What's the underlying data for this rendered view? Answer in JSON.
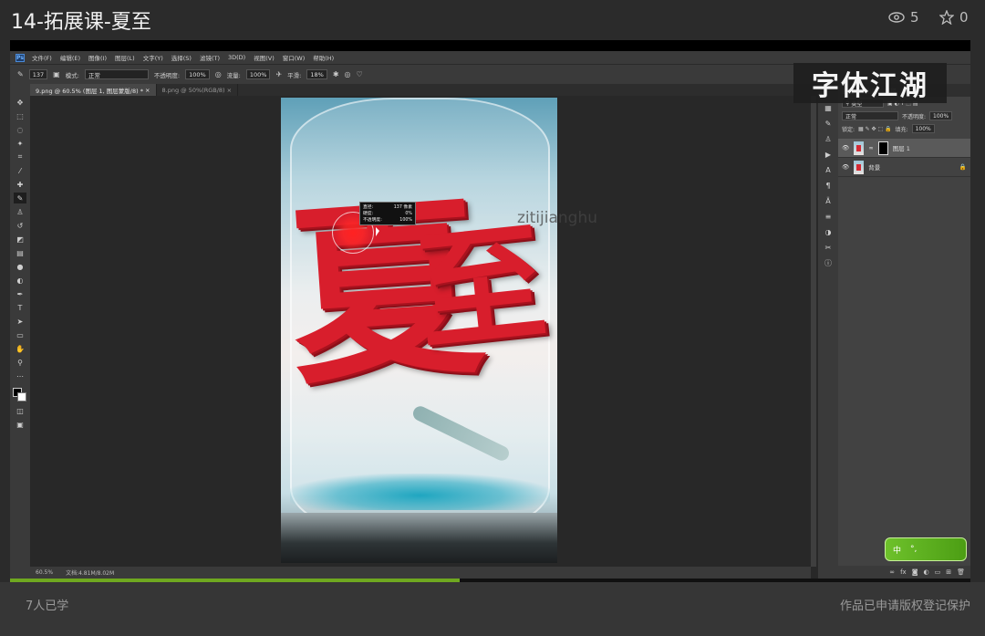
{
  "header": {
    "title": "14-拓展课-夏至",
    "views": "5",
    "stars": "0"
  },
  "photoshop": {
    "menu": [
      "文件(F)",
      "编辑(E)",
      "图像(I)",
      "图层(L)",
      "文字(Y)",
      "选择(S)",
      "滤镜(T)",
      "3D(D)",
      "视图(V)",
      "窗口(W)",
      "帮助(H)"
    ],
    "options": {
      "brush_size": "137",
      "mode_label": "模式:",
      "mode_value": "正常",
      "opacity_label": "不透明度:",
      "opacity_value": "100%",
      "flow_label": "流量:",
      "flow_value": "100%",
      "smooth_label": "平滑:",
      "smooth_value": "18%"
    },
    "tabs": [
      {
        "label": "9.png @ 60.5% (图层 1, 图层蒙版/8) *",
        "active": true
      },
      {
        "label": "8.png @ 50%(RGB/8)",
        "active": false
      }
    ],
    "status": {
      "zoom": "60.5%",
      "doc": "文档:4.81M/8.02M"
    },
    "brush_tooltip": {
      "size_label": "直径:",
      "size_value": "137 像素",
      "hardness_label": "硬度:",
      "hardness_value": "0%",
      "opacity_label": "不透明度:",
      "opacity_value": "100%"
    },
    "artwork_text": {
      "char1": "夏",
      "char2": "至"
    },
    "layers_panel": {
      "tabs": [
        "图层",
        "通道",
        "路径",
        "3D"
      ],
      "filter_kind": "类型",
      "blend_mode": "正常",
      "opacity_label": "不透明度:",
      "opacity_value": "100%",
      "lock_label": "锁定:",
      "fill_label": "填充:",
      "fill_value": "100%",
      "layers": [
        {
          "name": "图层 1",
          "selected": true,
          "has_mask": true
        },
        {
          "name": "背景",
          "selected": false,
          "has_mask": false
        }
      ]
    }
  },
  "overlay": {
    "watermark_url": "zitijianghu",
    "logo_text": "字体江湖",
    "ime_label": "中"
  },
  "playback": {
    "progress": 0.468
  },
  "footer": {
    "learners": "7人已学",
    "copyright": "作品已申请版权登记保护"
  }
}
